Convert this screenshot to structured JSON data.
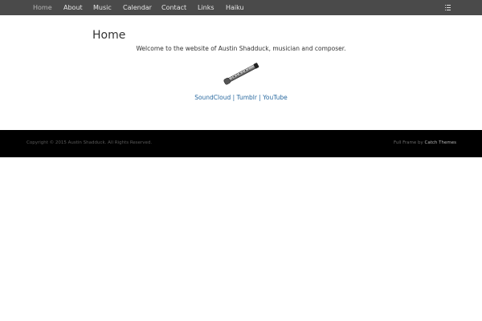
{
  "nav": {
    "items": [
      {
        "label": "Home"
      },
      {
        "label": "About"
      },
      {
        "label": "Music"
      },
      {
        "label": "Calendar"
      },
      {
        "label": "Contact"
      },
      {
        "label": "Links"
      },
      {
        "label": "Haiku"
      }
    ],
    "menu_icon": "menu-icon"
  },
  "content": {
    "title": "Home",
    "welcome": "Welcome to the website of Austin Shadduck, musician and composer.",
    "image_icon": "shakuhachi-flute-image",
    "links": [
      {
        "label": "SoundCloud"
      },
      {
        "label": "Tumblr"
      },
      {
        "label": "YouTube"
      }
    ],
    "separator": "|"
  },
  "footer": {
    "copyright": "Copyright © 2015 Austin Shadduck. All Rights Reserved.",
    "credit_prefix": "Full Frame by",
    "credit_link": "Catch Themes"
  },
  "colors": {
    "nav_bg": "#4a4a4a",
    "link": "#2a6aa0",
    "footer_bg": "#000000"
  }
}
